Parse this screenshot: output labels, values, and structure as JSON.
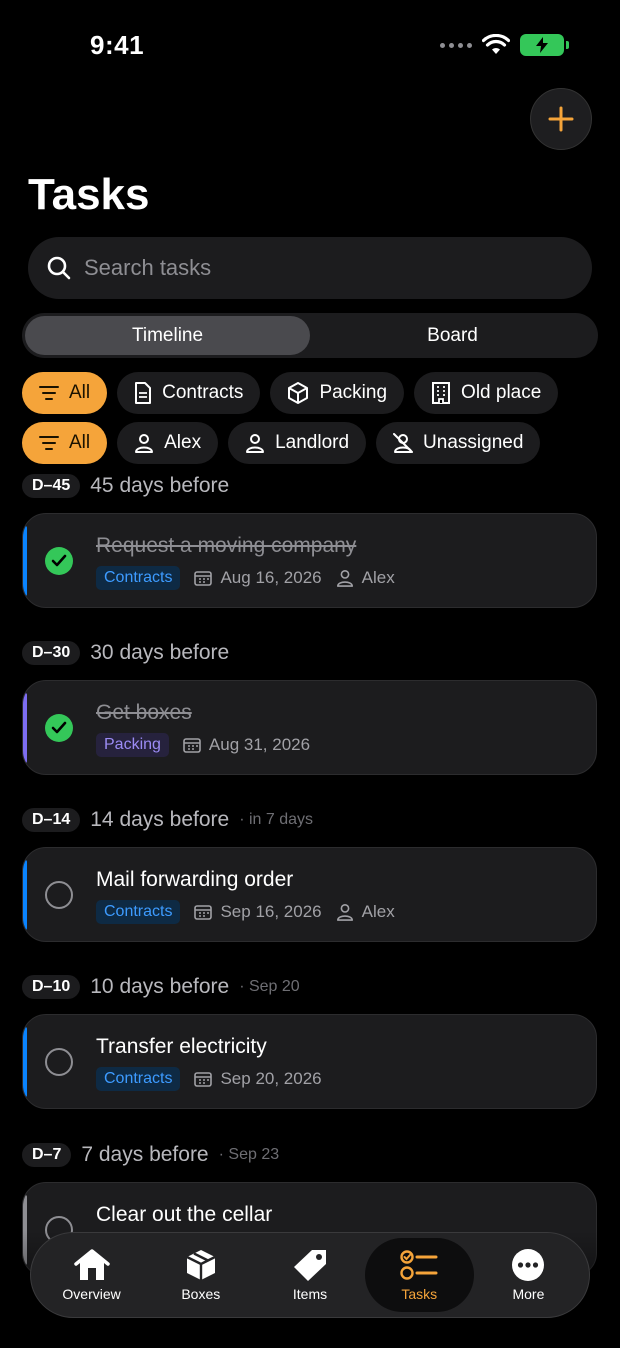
{
  "status_bar": {
    "time": "9:41"
  },
  "header": {
    "title": "Tasks"
  },
  "search": {
    "placeholder": "Search tasks"
  },
  "segments": [
    {
      "label": "Timeline",
      "active": true
    },
    {
      "label": "Board",
      "active": false
    }
  ],
  "category_filters": [
    {
      "label": "All",
      "icon": "filter-icon",
      "active": true
    },
    {
      "label": "Contracts",
      "icon": "document-icon",
      "active": false
    },
    {
      "label": "Packing",
      "icon": "box-icon",
      "active": false
    },
    {
      "label": "Old place",
      "icon": "building-icon",
      "active": false
    }
  ],
  "assignee_filters": [
    {
      "label": "All",
      "icon": "filter-icon",
      "active": true
    },
    {
      "label": "Alex",
      "icon": "person-icon",
      "active": false
    },
    {
      "label": "Landlord",
      "icon": "person-icon",
      "active": false
    },
    {
      "label": "Unassigned",
      "icon": "person-slash-icon",
      "active": false
    }
  ],
  "sections": [
    {
      "badge": "D–45",
      "title": "45 days before",
      "subtitle": "",
      "tasks": [
        {
          "title": "Request a moving company",
          "done": true,
          "tag": "Contracts",
          "date": "Aug 16, 2026",
          "assignee": "Alex",
          "accent": "#0a84ff"
        }
      ]
    },
    {
      "badge": "D–30",
      "title": "30 days before",
      "subtitle": "",
      "tasks": [
        {
          "title": "Get boxes",
          "done": true,
          "tag": "Packing",
          "date": "Aug 31, 2026",
          "assignee": "",
          "accent": "#7d6df2"
        }
      ]
    },
    {
      "badge": "D–14",
      "title": "14 days before",
      "subtitle": "· in 7 days",
      "tasks": [
        {
          "title": "Mail forwarding order",
          "done": false,
          "tag": "Contracts",
          "date": "Sep 16, 2026",
          "assignee": "Alex",
          "accent": "#0a84ff"
        }
      ]
    },
    {
      "badge": "D–10",
      "title": "10 days before",
      "subtitle": "· Sep 20",
      "tasks": [
        {
          "title": "Transfer electricity",
          "done": false,
          "tag": "Contracts",
          "date": "Sep 20, 2026",
          "assignee": "",
          "accent": "#0a84ff"
        }
      ]
    },
    {
      "badge": "D–7",
      "title": "7 days before",
      "subtitle": "· Sep 23",
      "tasks": [
        {
          "title": "Clear out the cellar",
          "done": false,
          "tag": "",
          "date": "",
          "assignee": "",
          "accent": "#8e8e93"
        }
      ]
    }
  ],
  "tab_bar": [
    {
      "label": "Overview",
      "icon": "house-icon",
      "active": false
    },
    {
      "label": "Boxes",
      "icon": "box-icon",
      "active": false
    },
    {
      "label": "Items",
      "icon": "tag-icon",
      "active": false
    },
    {
      "label": "Tasks",
      "icon": "checklist-icon",
      "active": true
    },
    {
      "label": "More",
      "icon": "more-icon",
      "active": false
    }
  ],
  "colors": {
    "accent": "#f5a43a",
    "done": "#34c759",
    "contracts": "#0a84ff",
    "packing": "#7d6df2"
  }
}
